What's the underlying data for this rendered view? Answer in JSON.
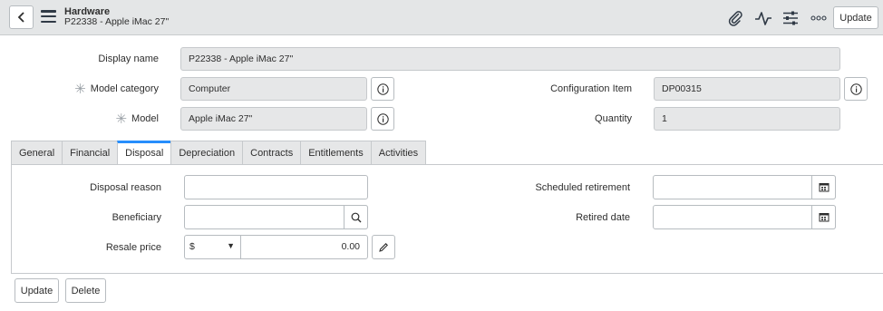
{
  "header": {
    "title": "Hardware",
    "subtitle": "P22338 - Apple iMac 27\"",
    "update_label": "Update"
  },
  "record": {
    "display_name": {
      "label": "Display name",
      "value": "P22338 - Apple iMac 27\""
    },
    "model_category": {
      "label": "Model category",
      "value": "Computer",
      "required": true
    },
    "model": {
      "label": "Model",
      "value": "Apple iMac 27\"",
      "required": true
    },
    "configuration_item": {
      "label": "Configuration Item",
      "value": "DP00315"
    },
    "quantity": {
      "label": "Quantity",
      "value": "1"
    }
  },
  "tabs": [
    {
      "label": "General",
      "active": false
    },
    {
      "label": "Financial",
      "active": false
    },
    {
      "label": "Disposal",
      "active": true
    },
    {
      "label": "Depreciation",
      "active": false
    },
    {
      "label": "Contracts",
      "active": false
    },
    {
      "label": "Entitlements",
      "active": false
    },
    {
      "label": "Activities",
      "active": false
    }
  ],
  "disposal": {
    "disposal_reason": {
      "label": "Disposal reason",
      "value": ""
    },
    "beneficiary": {
      "label": "Beneficiary",
      "value": ""
    },
    "resale_price": {
      "label": "Resale price",
      "currency": "$",
      "amount": "0.00"
    },
    "scheduled_retirement": {
      "label": "Scheduled retirement",
      "value": ""
    },
    "retired_date": {
      "label": "Retired date",
      "value": ""
    }
  },
  "footer": {
    "update_label": "Update",
    "delete_label": "Delete"
  },
  "colors": {
    "header_bg": "#e4e6e7",
    "active_tab_accent": "#278efc",
    "readonly_field_bg": "#e6e7e8"
  }
}
